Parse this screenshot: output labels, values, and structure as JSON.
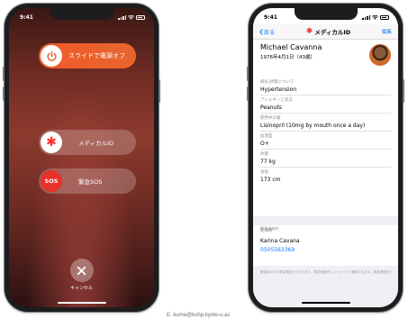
{
  "left_phone": {
    "status_time": "9:41",
    "power_slider_label": "スライドで電源オフ",
    "medical_id_label": "メディカルID",
    "sos_knob_text": "SOS",
    "sos_label": "緊急SOS",
    "cancel_label": "キャンセル"
  },
  "right_phone": {
    "status_time": "9:41",
    "nav": {
      "back_label": "戻る",
      "title": "メディカルID",
      "edit_label": "編集"
    },
    "profile": {
      "name": "Michael Cavanna",
      "dob": "1976年4月1日（43歳）"
    },
    "fields": [
      {
        "label": "病気/状態について",
        "value": "Hypertension"
      },
      {
        "label": "アレルギーと反応",
        "value": "Peanuts"
      },
      {
        "label": "使用中の薬",
        "value": "Lisinopril (10mg by mouth once a day)"
      },
      {
        "label": "血液型",
        "value": "O+"
      },
      {
        "label": "体重",
        "value": "77 kg"
      },
      {
        "label": "身長",
        "value": "173 cm"
      }
    ],
    "emergency_section_label": "緊急連絡先",
    "contact": {
      "role": "配偶者",
      "name": "Karina Cavana",
      "phone": "0505563369"
    },
    "footer_text": "緊急時SOSで緊急電話をかけたあと、緊急連絡先にメッセージで通知されます。緊急連絡先を"
  },
  "credit": "E. kume@kuhp.kyoto-u.ac",
  "colors": {
    "power_orange": "#f05a2a",
    "medical_red": "#ff2d2d",
    "sos_red": "#e8312b",
    "ios_blue": "#0a7aff"
  },
  "icons": {
    "power": "power-icon",
    "medical": "asterisk-icon",
    "cancel": "close-icon",
    "back": "chevron-left-icon"
  }
}
